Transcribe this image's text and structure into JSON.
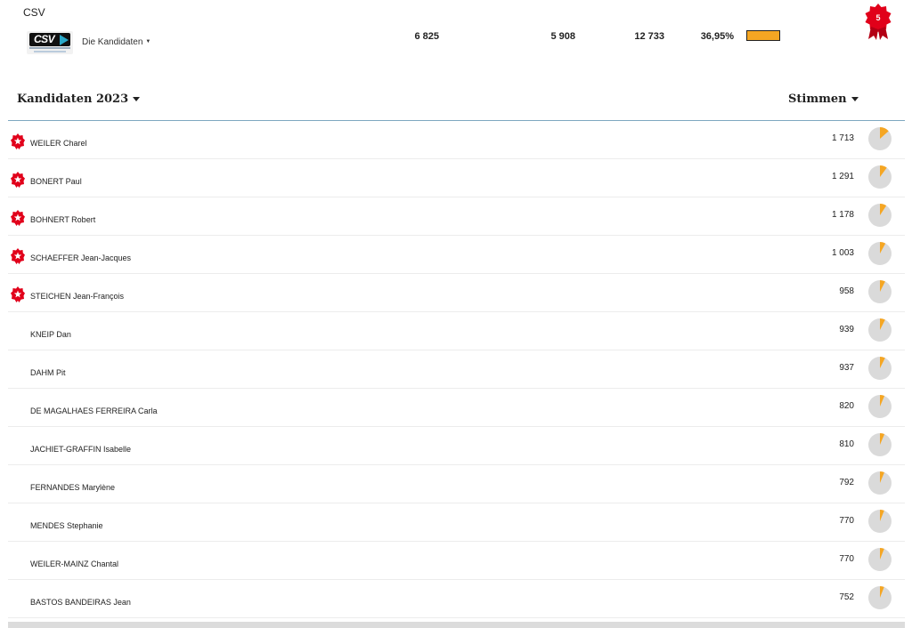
{
  "party": {
    "name": "CSV",
    "logo_text": "CSV",
    "candidates_toggle_label": "Die Kandidaten",
    "stats": [
      "6 825",
      "5 908",
      "12 733"
    ],
    "percentage": "36,95%",
    "percentage_value": 36.95,
    "seats": "5",
    "bar_color": "#f5a623",
    "seat_color": "#e1001a"
  },
  "table": {
    "candidates_header": "Kandidaten 2023",
    "votes_header": "Stimmen"
  },
  "candidates": [
    {
      "name": "WEILER Charel",
      "votes": "1 713",
      "share": 0.134,
      "elected": true
    },
    {
      "name": "BONERT Paul",
      "votes": "1 291",
      "share": 0.101,
      "elected": true
    },
    {
      "name": "BOHNERT Robert",
      "votes": "1 178",
      "share": 0.093,
      "elected": true
    },
    {
      "name": "SCHAEFFER Jean-Jacques",
      "votes": "1 003",
      "share": 0.079,
      "elected": true
    },
    {
      "name": "STEICHEN Jean-François",
      "votes": "958",
      "share": 0.075,
      "elected": true
    },
    {
      "name": "KNEIP Dan",
      "votes": "939",
      "share": 0.074,
      "elected": false
    },
    {
      "name": "DAHM Pit",
      "votes": "937",
      "share": 0.074,
      "elected": false
    },
    {
      "name": "DE MAGALHAES FERREIRA Carla",
      "votes": "820",
      "share": 0.064,
      "elected": false
    },
    {
      "name": "JACHIET-GRAFFIN Isabelle",
      "votes": "810",
      "share": 0.064,
      "elected": false
    },
    {
      "name": "FERNANDES Marylène",
      "votes": "792",
      "share": 0.062,
      "elected": false
    },
    {
      "name": "MENDES Stephanie",
      "votes": "770",
      "share": 0.06,
      "elected": false
    },
    {
      "name": "WEILER-MAINZ Chantal",
      "votes": "770",
      "share": 0.06,
      "elected": false
    },
    {
      "name": "BASTOS BANDEIRAS Jean",
      "votes": "752",
      "share": 0.059,
      "elected": false
    }
  ],
  "colors": {
    "pie_background": "#dadada",
    "pie_slice": "#f5a623",
    "elected_badge": "#e1001a"
  }
}
